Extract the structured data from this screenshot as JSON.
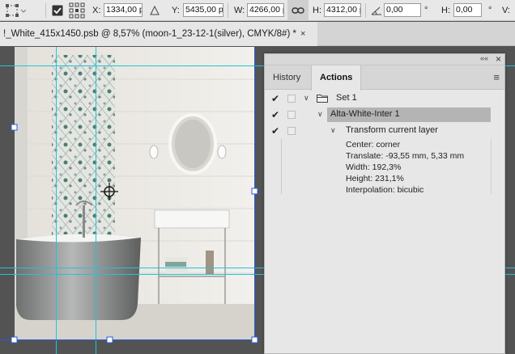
{
  "options_bar": {
    "x_label": "X:",
    "x_value": "1334,00 p:",
    "y_label": "Y:",
    "y_value": "5435,00 p:",
    "w_label": "W:",
    "w_value": "4266,00 p",
    "h_label": "H:",
    "h_value": "4312,00 p",
    "angle_value": "0,00",
    "angle_unit": "°",
    "hskew_label": "H:",
    "hskew_value": "0,00",
    "vskew_label": "V:"
  },
  "document_tab": {
    "title": "!_White_415x1450.psb @ 8,57% (moon-1_23-12-1(silver), CMYK/8#) *",
    "close": "×"
  },
  "panel": {
    "collapse": "««",
    "close": "×",
    "tabs": [
      "History",
      "Actions"
    ],
    "active_tab": "Actions",
    "menu_icon": "≡",
    "rows": {
      "set_label": "Set 1",
      "action_label": "Alta-White-Inter 1",
      "step_label": "Transform current layer",
      "details": [
        "Center: corner",
        "Translate: -93,55 mm, 5,33 mm",
        "Width: 192,3%",
        "Height: 231,1%",
        "Interpolation: bicubic"
      ]
    }
  },
  "colors": {
    "options_bg": "#e8e8e8",
    "panel_bg": "#e7e7e7",
    "selected_row": "#b4b4b4",
    "guide": "#20c4d8",
    "handle": "#2b5cd8"
  }
}
